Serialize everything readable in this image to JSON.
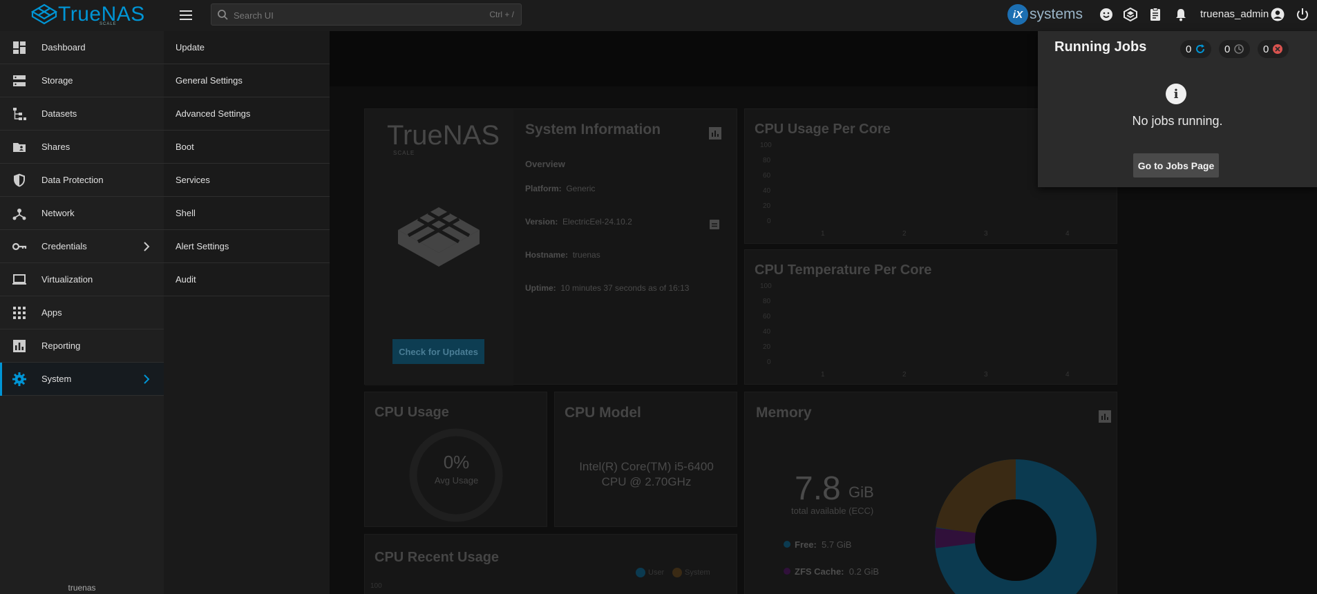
{
  "app": {
    "logo_text": "TrueNAS",
    "logo_sub": "SCALE",
    "vendor_mark": "iX",
    "vendor_text": "systems"
  },
  "search": {
    "placeholder": "Search UI",
    "shortcut": "Ctrl + /"
  },
  "topbar": {
    "username": "truenas_admin",
    "icons": [
      "feedback-icon",
      "truecommand-icon",
      "jobs-icon",
      "notifications-icon",
      "account-icon",
      "power-icon"
    ]
  },
  "sidebar": {
    "items": [
      {
        "label": "Dashboard",
        "icon": "dashboard-icon"
      },
      {
        "label": "Storage",
        "icon": "storage-icon"
      },
      {
        "label": "Datasets",
        "icon": "datasets-icon"
      },
      {
        "label": "Shares",
        "icon": "shares-icon"
      },
      {
        "label": "Data Protection",
        "icon": "shield-icon"
      },
      {
        "label": "Network",
        "icon": "network-icon"
      },
      {
        "label": "Credentials",
        "icon": "key-icon"
      },
      {
        "label": "Virtualization",
        "icon": "laptop-icon"
      },
      {
        "label": "Apps",
        "icon": "apps-grid-icon"
      },
      {
        "label": "Reporting",
        "icon": "bar-chart-icon"
      },
      {
        "label": "System",
        "icon": "gear-icon"
      }
    ],
    "active": "System",
    "footer_hostname": "truenas"
  },
  "submenu": {
    "items": [
      "Update",
      "General Settings",
      "Advanced Settings",
      "Boot",
      "Services",
      "Shell",
      "Alert Settings",
      "Audit"
    ]
  },
  "dashboard": {
    "sysinfo": {
      "title": "System Information",
      "overview": "Overview",
      "platform_label": "Platform:",
      "platform": "Generic",
      "version_label": "Version:",
      "version": "ElectricEel-24.10.2",
      "hostname_label": "Hostname:",
      "hostname": "truenas",
      "uptime_label": "Uptime:",
      "uptime": "10 minutes 37 seconds as of 16:13",
      "check_updates": "Check for Updates",
      "logo_text": "TrueNAS",
      "logo_sub": "SCALE"
    },
    "cpu_usage_per_core": {
      "title": "CPU Usage Per Core",
      "y_ticks": [
        "100",
        "80",
        "60",
        "40",
        "20",
        "0"
      ],
      "x_ticks": [
        "1",
        "2",
        "3",
        "4"
      ]
    },
    "cpu_temp_per_core": {
      "title": "CPU Temperature Per Core",
      "y_ticks": [
        "100",
        "80",
        "60",
        "40",
        "20",
        "0"
      ],
      "x_ticks": [
        "1",
        "2",
        "3",
        "4"
      ]
    },
    "cpu_usage": {
      "title": "CPU Usage",
      "percent": "0%",
      "caption": "Avg Usage"
    },
    "cpu_model": {
      "title": "CPU Model",
      "line1": "Intel(R) Core(TM) i5-6400",
      "line2": "CPU @ 2.70GHz"
    },
    "memory": {
      "title": "Memory",
      "total_value": "7.8",
      "total_unit": "GiB",
      "total_caption": "total available (ECC)",
      "free_label": "Free:",
      "free_value": "5.7 GiB",
      "zfs_label": "ZFS Cache:",
      "zfs_value": "0.2 GiB",
      "colors": {
        "free": "#0095d5",
        "zfs": "#7a1f8a",
        "services": "#d98a2b"
      }
    },
    "cpu_recent": {
      "title": "CPU Recent Usage",
      "legend_user": "User",
      "legend_system": "System",
      "y_top": "100"
    }
  },
  "jobs": {
    "title": "Running Jobs",
    "running_count": "0",
    "waiting_count": "0",
    "failed_count": "0",
    "empty_text": "No jobs running.",
    "button_label": "Go to Jobs Page"
  },
  "colors": {
    "accent": "#0095d5",
    "background": "#111111",
    "panel": "#2b2b2b",
    "failed": "#d9534f"
  }
}
